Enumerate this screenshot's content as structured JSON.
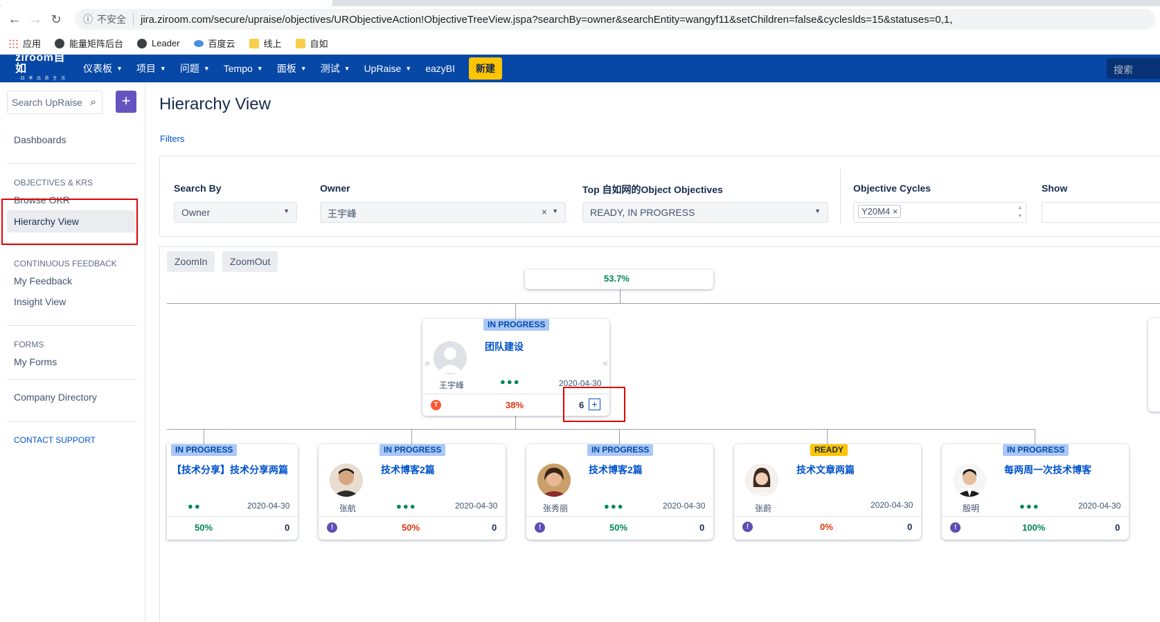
{
  "browser": {
    "insecure_label": "不安全",
    "url": "jira.ziroom.com/secure/upraise/objectives/URObjectiveAction!ObjectiveTreeView.jspa?searchBy=owner&searchEntity=wangyf11&setChildren=false&cycleslds=15&statuses=0,1,",
    "bookmarks": [
      "应用",
      "能量矩阵后台",
      "Leader",
      "百度云",
      "线上",
      "自如"
    ]
  },
  "header": {
    "logo_text": "ziroom自如",
    "logo_sub": "· 四 季 品 质 生 活 ·",
    "menu": [
      "仪表板",
      "项目",
      "问题",
      "Tempo",
      "面板",
      "测试",
      "UpRaise",
      "eazyBI"
    ],
    "create_label": "新建",
    "search_placeholder": "搜索"
  },
  "sidebar": {
    "search_placeholder": "Search UpRaise",
    "add_label": "+",
    "dashboards": "Dashboards",
    "section_okr": "OBJECTIVES & KRS",
    "browse_okr": "Browse OKR",
    "hierarchy_view": "Hierarchy View",
    "section_feedback": "CONTINUOUS FEEDBACK",
    "my_feedback": "My Feedback",
    "insight_view": "Insight View",
    "section_forms": "FORMS",
    "my_forms": "My Forms",
    "company_directory": "Company Directory",
    "contact_support": "CONTACT SUPPORT"
  },
  "main": {
    "title": "Hierarchy View",
    "filters_link": "Filters",
    "filters": {
      "search_by_label": "Search By",
      "search_by_value": "Owner",
      "owner_label": "Owner",
      "owner_value": "王宇峰",
      "top_label": "Top 自如网的Object Objectives",
      "top_value": "READY, IN PROGRESS",
      "cycles_label": "Objective Cycles",
      "cycle_tag": "Y20M4 ×",
      "show_label": "Show"
    },
    "zoom_in": "ZoomIn",
    "zoom_out": "ZoomOut",
    "root_partial": {
      "percent": "53.7%"
    },
    "parent_card": {
      "status": "IN PROGRESS",
      "title": "团队建设",
      "owner": "王宇峰",
      "date": "2020-04-30",
      "type_badge": "T",
      "percent": "38%",
      "child_count": "6",
      "expand": "+"
    },
    "children": [
      {
        "status": "IN PROGRESS",
        "title": "【技术分享】技术分享两篇",
        "owner": "",
        "date": "2020-04-30",
        "percent": "50%",
        "count": "0",
        "pct_color": "green"
      },
      {
        "status": "IN PROGRESS",
        "title": "技术博客2篇",
        "owner": "张航",
        "date": "2020-04-30",
        "percent": "50%",
        "count": "0",
        "pct_color": "red"
      },
      {
        "status": "IN PROGRESS",
        "title": "技术博客2篇",
        "owner": "张秀丽",
        "date": "2020-04-30",
        "percent": "50%",
        "count": "0",
        "pct_color": "green"
      },
      {
        "status": "READY",
        "title": "技术文章两篇",
        "owner": "张蔚",
        "date": "2020-04-30",
        "percent": "0%",
        "count": "0",
        "pct_color": "red"
      },
      {
        "status": "IN PROGRESS",
        "title": "每两周一次技术博客",
        "owner": "殷明",
        "date": "2020-04-30",
        "percent": "100%",
        "count": "0",
        "pct_color": "green"
      }
    ],
    "child_badge": "!"
  },
  "colors": {
    "jira_blue": "#0747a6",
    "create_yellow": "#ffc400",
    "add_purple": "#6554c0",
    "progress_blue": "#a8c8f8",
    "annotation_red": "#e30000"
  }
}
